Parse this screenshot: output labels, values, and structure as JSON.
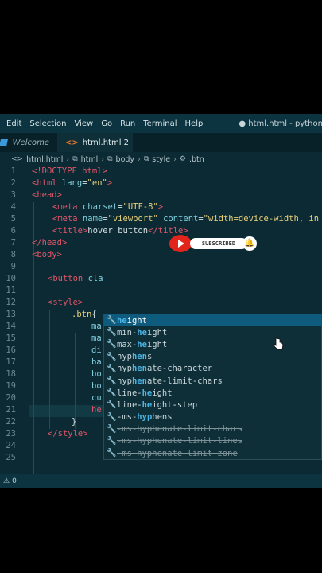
{
  "menu": {
    "items": [
      "Edit",
      "Selection",
      "View",
      "Go",
      "Run",
      "Terminal",
      "Help"
    ],
    "window_title": "● html.html - python - Visual St"
  },
  "tabs": [
    {
      "label": "Welcome",
      "icon": "vscode-icon"
    },
    {
      "label": "html.html 2",
      "icon": "html-file-icon",
      "dirty": true
    }
  ],
  "breadcrumb": [
    "html.html",
    "html",
    "body",
    "style",
    ".btn"
  ],
  "editor": {
    "line_numbers": [
      "1",
      "2",
      "3",
      "4",
      "5",
      "6",
      "7",
      "8",
      "9",
      "10",
      "11",
      "12",
      "13",
      "14",
      "15",
      "16",
      "17",
      "18",
      "19",
      "20",
      "21",
      "22",
      "23",
      "24",
      "25"
    ],
    "lines": {
      "l1": [
        "<!DOCTYPE html>"
      ],
      "l2": [
        "<html",
        " lang",
        "=",
        "\"en\"",
        ">"
      ],
      "l3": [
        "<head>"
      ],
      "l4": [
        "<meta",
        " charset",
        "=",
        "\"UTF-8\"",
        ">"
      ],
      "l5": [
        "<meta",
        " name",
        "=",
        "\"viewport\"",
        " content",
        "=",
        "\"width=device-width, in"
      ],
      "l6": [
        "<title>",
        "hover button",
        "</title>"
      ],
      "l7": [
        "</head>"
      ],
      "l8": [
        "<body>"
      ],
      "l10": [
        "<button",
        " cla"
      ],
      "l12": [
        "<style>"
      ],
      "l13": [
        ".btn",
        "{"
      ],
      "l14": [
        "ma"
      ],
      "l15": [
        "ma"
      ],
      "l16": [
        "di"
      ],
      "l17": [
        "ba"
      ],
      "l18": [
        "bo"
      ],
      "l19": [
        "bo"
      ],
      "l20": [
        "cu"
      ],
      "l21": [
        "he"
      ],
      "l22": [
        "}"
      ],
      "l23": [
        "</style>"
      ]
    }
  },
  "suggestions": [
    {
      "pre": "",
      "match": "he",
      "post": "ight",
      "selected": true,
      "strike": false
    },
    {
      "pre": "min-",
      "match": "he",
      "post": "ight",
      "selected": false,
      "strike": false
    },
    {
      "pre": "max-",
      "match": "he",
      "post": "ight",
      "selected": false,
      "strike": false
    },
    {
      "pre": "hyp",
      "match": "hen",
      "post": "s",
      "selected": false,
      "strike": false
    },
    {
      "pre": "hyp",
      "match": "hen",
      "post": "ate-character",
      "selected": false,
      "strike": false
    },
    {
      "pre": "hyp",
      "match": "hen",
      "post": "ate-limit-chars",
      "selected": false,
      "strike": false
    },
    {
      "pre": "line-",
      "match": "he",
      "post": "ight",
      "selected": false,
      "strike": false
    },
    {
      "pre": "line-",
      "match": "he",
      "post": "ight-step",
      "selected": false,
      "strike": false
    },
    {
      "pre": "-ms-",
      "match": "hyp",
      "post": "hens",
      "selected": false,
      "strike": false
    },
    {
      "pre": "",
      "match": "",
      "post": "-ms-hyphenate-limit-chars",
      "selected": false,
      "strike": true
    },
    {
      "pre": "",
      "match": "",
      "post": "-ms-hyphenate-limit-lines",
      "selected": false,
      "strike": true
    },
    {
      "pre": "",
      "match": "",
      "post": "-ms-hyphenate-limit-zone",
      "selected": false,
      "strike": true
    }
  ],
  "overlay": {
    "subscribed_label": "SUBSCRIBED"
  },
  "status": {
    "problems": "0"
  },
  "colors": {
    "editor_bg": "#0c2a33",
    "menubar_bg": "#0b3340",
    "tag": "#e0566a",
    "attribute": "#7fd0dd",
    "string": "#e8d07a",
    "suggest_selected": "#0e5b7d",
    "match_highlight": "#4ab6e6",
    "youtube_red": "#e1251b"
  }
}
